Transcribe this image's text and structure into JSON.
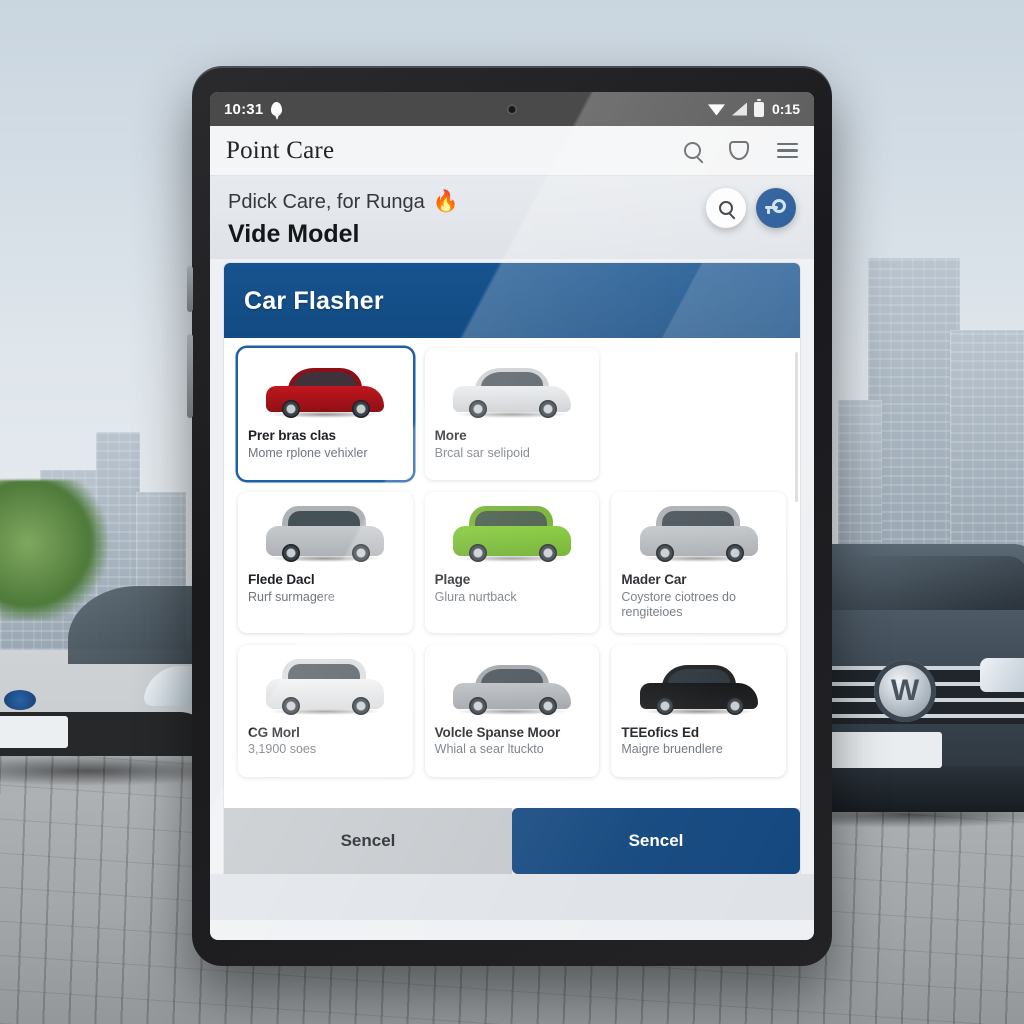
{
  "status_bar": {
    "clock": "10:31",
    "location_icon": "location-pin-icon",
    "wifi_icon": "wifi-icon",
    "signal_icon": "cellular-signal-icon",
    "battery_icon": "battery-icon",
    "battery_text": "0:15"
  },
  "app_bar": {
    "title": "Point Care",
    "icons": [
      "search-icon",
      "bag-icon",
      "hamburger-menu-icon"
    ]
  },
  "hero": {
    "eyebrow": "Pdick Care, for Runga",
    "flame": "🔥",
    "headline": "Vide Model",
    "fab_search": "search-icon",
    "fab_key": "key-icon"
  },
  "dialog": {
    "title": "Car Flasher",
    "cards": [
      {
        "name": "Prer bras clas",
        "desc": "Mome rplone vehixler",
        "selected": true,
        "body": "#c1161d",
        "roof": "#8d1016",
        "shape": "sedan"
      },
      {
        "name": "More",
        "desc": "Brcal sar selipoid",
        "selected": false,
        "body": "#e8eaec",
        "roof": "#c9ccd0",
        "shape": "sedan"
      },
      {
        "name": "",
        "desc": "",
        "selected": false,
        "body": "",
        "roof": "",
        "shape": "empty"
      },
      {
        "name": "Flede Dacl",
        "desc": "Rurf surmagere",
        "selected": false,
        "body": "#c7cacd",
        "roof": "#aeb2b6",
        "shape": "suv"
      },
      {
        "name": "Plage",
        "desc": "Glura nurtback",
        "selected": false,
        "body": "#7ac62a",
        "roof": "#68ab22",
        "shape": "suv"
      },
      {
        "name": "Mader Car",
        "desc": "Coystore ciotroes do rengiteioes",
        "selected": false,
        "body": "#c3c6c9",
        "roof": "#a9adb1",
        "shape": "suv"
      },
      {
        "name": "CG Morl",
        "desc": "3,1900 soes",
        "selected": false,
        "body": "#f1f2f3",
        "roof": "#d8dadc",
        "shape": "suv"
      },
      {
        "name": "Volcle Spanse Moor",
        "desc": "Whial a sear ltuckto",
        "selected": false,
        "body": "#b9bdc1",
        "roof": "#9da1a5",
        "shape": "sedan"
      },
      {
        "name": "TEEofics Ed",
        "desc": "Maigre bruendlere",
        "selected": false,
        "body": "#121416",
        "roof": "#1d1f21",
        "shape": "sedan"
      }
    ],
    "actions": {
      "secondary_label": "Sencel",
      "primary_label": "Sencel"
    }
  },
  "colors": {
    "brand_blue": "#17538f",
    "primary_button": "#13477e",
    "secondary_button": "#c3c7cb",
    "selected_outline": "#1f5fa8"
  }
}
